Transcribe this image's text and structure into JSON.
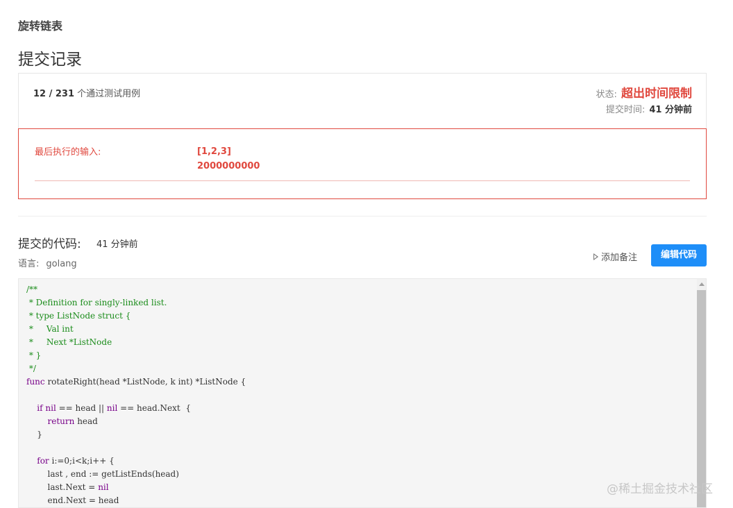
{
  "problem_title": "旋转链表",
  "page_title": "提交记录",
  "summary": {
    "passed": "12 / 231",
    "passed_suffix": "个通过测试用例",
    "status_label": "状态:",
    "status_value": "超出时间限制",
    "time_label": "提交时间:",
    "time_value": "41 分钟前"
  },
  "error": {
    "label": "最后执行的输入:",
    "input_line1": "[1,2,3]",
    "input_line2": "2000000000",
    "color": "#e0483e"
  },
  "code_section": {
    "title": "提交的代码:",
    "time": "41 分钟前",
    "lang_label": "语言:",
    "lang_value": "golang",
    "add_note": "添加备注",
    "edit_button": "编辑代码",
    "button_color": "#1e8ef8"
  },
  "code": {
    "line1": "/**",
    "line2": " * Definition for singly-linked list.",
    "line3": " * type ListNode struct {",
    "line4": " *     Val int",
    "line5": " *     Next *ListNode",
    "line6": " * }",
    "line7": " */",
    "line8_kw": "func",
    "line8_rest": " rotateRight(head *ListNode, k int) *ListNode {",
    "line10_kw1": "if",
    "line10_kw2": "nil",
    "line10_mid": " == head || ",
    "line10_kw3": "nil",
    "line10_rest": " == head.Next  {",
    "line11_kw": "return",
    "line11_rest": " head",
    "line12": "    }",
    "line14_kw": "for",
    "line14_rest": " i:=0;i<k;i++ {",
    "line15": "        last , end := getListEnds(head)",
    "line16_a": "        last.Next = ",
    "line16_kw": "nil",
    "line17": "        end.Next = head"
  },
  "watermark": "@稀土掘金技术社区"
}
